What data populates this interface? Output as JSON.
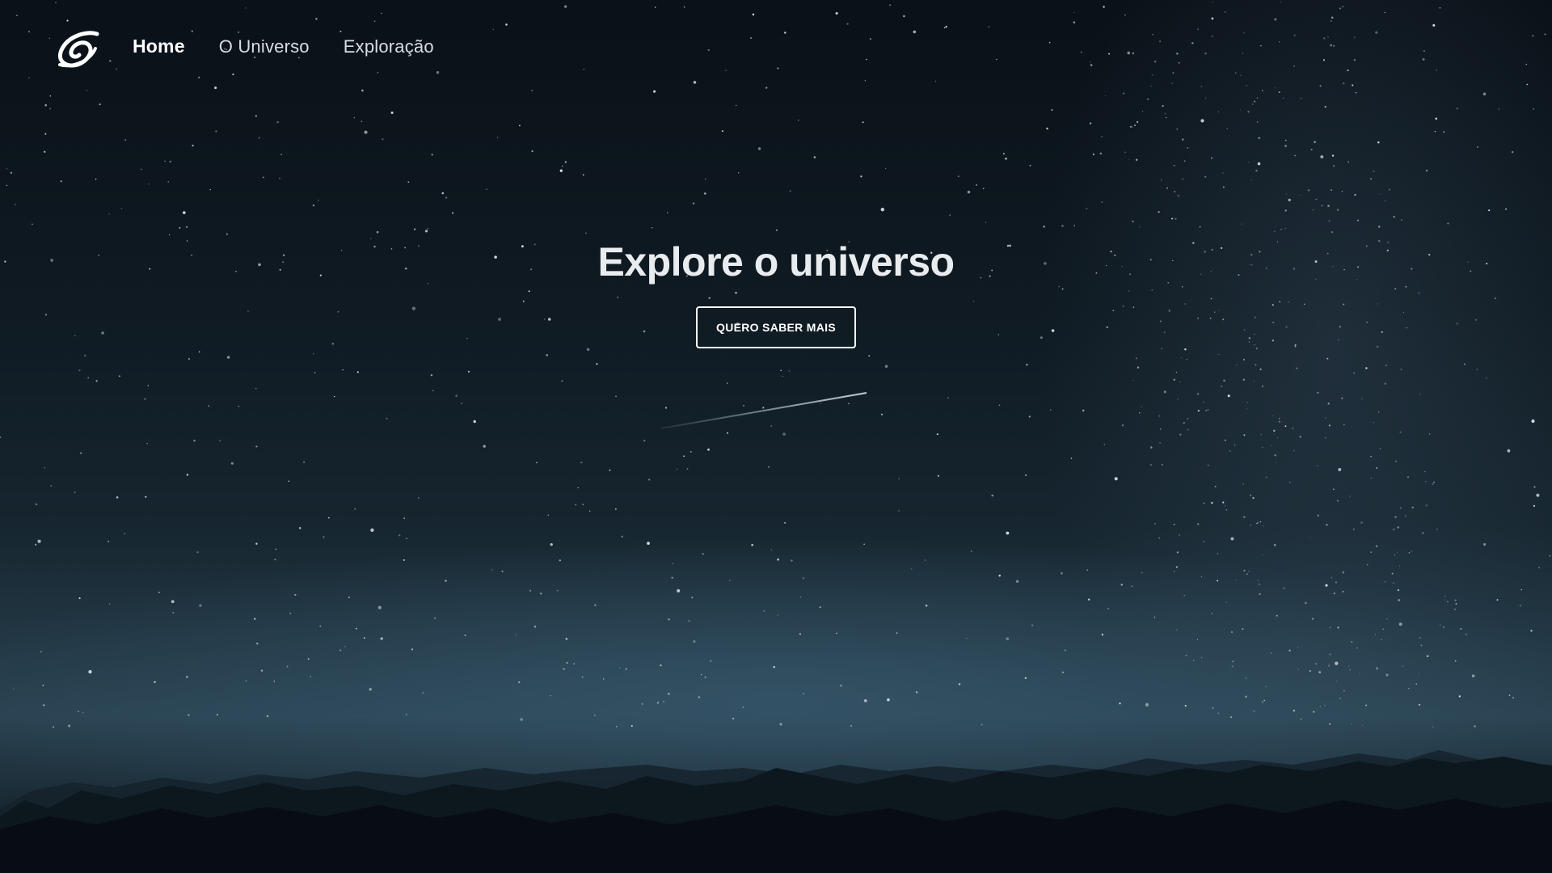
{
  "nav": {
    "logo": "spiral-galaxy-logo",
    "items": [
      {
        "label": "Home",
        "active": true
      },
      {
        "label": "O Universo",
        "active": false
      },
      {
        "label": "Exploração",
        "active": false
      }
    ]
  },
  "hero": {
    "title": "Explore o universo",
    "button_label": "QUERO SABER MAIS"
  },
  "colors": {
    "sky_top": "#0a1118",
    "horizon": "#2a4352",
    "mountains": "#070d12",
    "text": "#ffffff"
  }
}
